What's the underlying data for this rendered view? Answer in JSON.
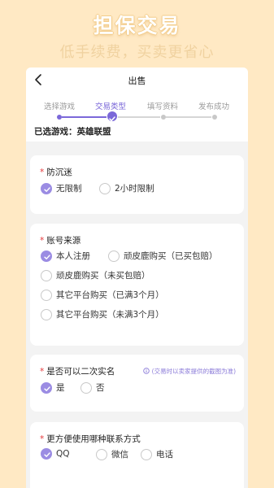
{
  "promo": {
    "title": "担保交易",
    "subtitle": "低手续费，买卖更省心"
  },
  "navbar": {
    "title": "出售"
  },
  "steps": [
    {
      "label": "选择游戏",
      "state": "done"
    },
    {
      "label": "交易类型",
      "state": "active"
    },
    {
      "label": "填写资料",
      "state": "todo"
    },
    {
      "label": "发布成功",
      "state": "todo"
    }
  ],
  "selected_game": "已选游戏：英雄联盟",
  "questions": {
    "anti_addiction": {
      "required_mark": "*",
      "title": "防沉迷",
      "options": [
        {
          "label": "无限制",
          "checked": true
        },
        {
          "label": "2小时限制",
          "checked": false
        }
      ]
    },
    "account_source": {
      "required_mark": "*",
      "title": "账号来源",
      "options": [
        {
          "label": "本人注册",
          "checked": true
        },
        {
          "label": "顽皮鹿购买（已买包赔）",
          "checked": false
        },
        {
          "label": "顽皮鹿购买（未买包赔）",
          "checked": false
        },
        {
          "label": "其它平台购买（已满3个月）",
          "checked": false
        },
        {
          "label": "其它平台购买（未满3个月）",
          "checked": false
        }
      ]
    },
    "rename": {
      "required_mark": "*",
      "title": "是否可以二次实名",
      "note": "(交易时以卖家提供的截图为准)",
      "options": [
        {
          "label": "是",
          "checked": true
        },
        {
          "label": "否",
          "checked": false
        }
      ]
    },
    "contact": {
      "required_mark": "*",
      "title": "更方便使用哪种联系方式",
      "options": [
        {
          "label": "QQ",
          "checked": true
        },
        {
          "label": "微信",
          "checked": false
        },
        {
          "label": "电话",
          "checked": false
        }
      ]
    }
  },
  "colors": {
    "background": "#ffe9c4",
    "accent": "#7b68d9",
    "radio_checked": "#9b8ce3",
    "required": "#e5383b"
  }
}
